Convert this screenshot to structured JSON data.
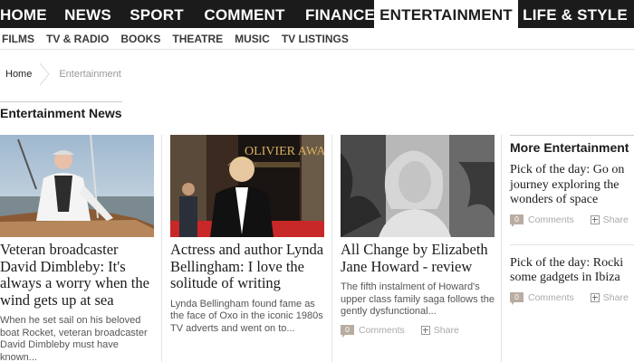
{
  "nav": {
    "items": [
      {
        "label": "HOME"
      },
      {
        "label": "NEWS"
      },
      {
        "label": "SPORT"
      },
      {
        "label": "COMMENT"
      },
      {
        "label": "FINANCE"
      },
      {
        "label": "ENTERTAINMENT",
        "active": true
      },
      {
        "label": "LIFE & STYLE"
      }
    ]
  },
  "subnav": {
    "items": [
      "FILMS",
      "TV & RADIO",
      "BOOKS",
      "THEATRE",
      "MUSIC",
      "TV LISTINGS"
    ]
  },
  "breadcrumb": {
    "home": "Home",
    "current": "Entertainment"
  },
  "section": {
    "title": "Entertainment News"
  },
  "articles": [
    {
      "headline": "Veteran broadcaster David Dimbleby: It's always a worry when the wind gets up at sea",
      "standfirst": "When he set sail on his beloved boat Rocket, veteran broadcaster David Dimbleby must have known..."
    },
    {
      "headline": "Actress and author Lynda Bellingham: I love the solitude of writing",
      "standfirst": "Lynda Bellingham found fame as the face of Oxo in the iconic 1980s TV adverts and went on to..."
    },
    {
      "headline": "All Change by Elizabeth Jane Howard - review",
      "standfirst": "The fifth instalment of Howard's upper class family saga follows the gently dysfunctional...",
      "comment_count": "0",
      "comments_label": "Comments",
      "share_label": "Share"
    }
  ],
  "image_text": {
    "olivier_sign": "OLIVIER AWARDS"
  },
  "sidebar": {
    "title": "More Entertainment",
    "items": [
      {
        "lines": [
          "Pick of the day: Go on",
          "journey exploring the",
          "wonders of space"
        ],
        "comment_count": "0",
        "comments_label": "Comments",
        "share_label": "Share"
      },
      {
        "lines": [
          "Pick of the day: Rocki",
          "some gadgets in Ibiza"
        ],
        "comment_count": "0",
        "comments_label": "Comments",
        "share_label": "Share"
      }
    ]
  },
  "colors": {
    "nav_bg": "#1b1b1b",
    "comment_badge": "#b9aca1"
  }
}
